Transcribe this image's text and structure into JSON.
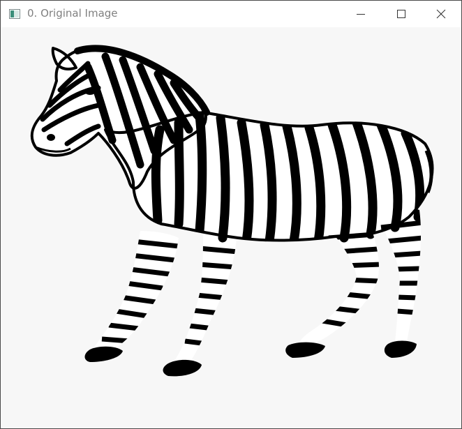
{
  "window": {
    "title": "0. Original Image",
    "app_icon": "opencv-window-icon"
  },
  "controls": {
    "minimize": "minimize-icon",
    "maximize": "maximize-icon",
    "close": "close-icon"
  },
  "colors": {
    "client_background": "#f7f7f7",
    "zebra_black": "#000000",
    "zebra_white": "#ffffff",
    "title_text": "#808080"
  }
}
